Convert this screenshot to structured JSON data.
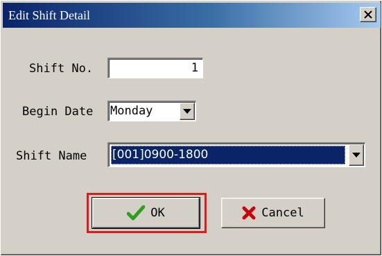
{
  "window": {
    "title": "Edit Shift Detail",
    "close_icon": "close-icon"
  },
  "form": {
    "shift_no": {
      "label": "Shift No.",
      "value": "1"
    },
    "begin_date": {
      "label": "Begin Date",
      "value": "Monday"
    },
    "shift_name": {
      "label": "Shift Name",
      "value": "[001]0900-1800"
    }
  },
  "buttons": {
    "ok": {
      "label": "OK",
      "icon": "check-icon",
      "icon_color": "#2e9e1f"
    },
    "cancel": {
      "label": "Cancel",
      "icon": "x-icon",
      "icon_color": "#c8000a"
    }
  },
  "colors": {
    "title_gradient_start": "#0a246a",
    "title_gradient_end": "#a6caf0",
    "selection_bg": "#0a246a",
    "highlight_box": "#e8151b"
  }
}
